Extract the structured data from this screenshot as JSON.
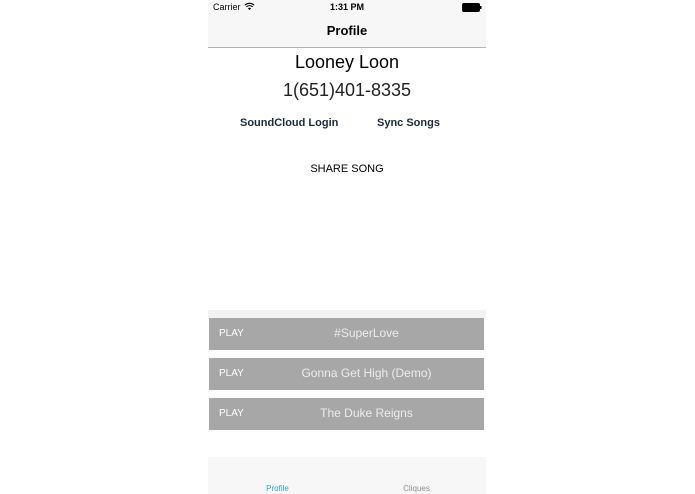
{
  "status_bar": {
    "carrier": "Carrier",
    "time": "1:31 PM"
  },
  "nav": {
    "title": "Profile"
  },
  "profile": {
    "name": "Looney Loon",
    "phone": "1(651)401-8335"
  },
  "actions": {
    "soundcloud_login": "SoundCloud Login",
    "sync_songs": "Sync Songs",
    "share_song": "SHARE SONG"
  },
  "songs": [
    {
      "play_label": "PLAY",
      "title": "#SuperLove"
    },
    {
      "play_label": "PLAY",
      "title": "Gonna Get High (Demo)"
    },
    {
      "play_label": "PLAY",
      "title": "The Duke Reigns"
    }
  ],
  "tabs": [
    {
      "label": "Profile",
      "selected": true
    },
    {
      "label": "Cliques",
      "selected": false
    }
  ],
  "colors": {
    "accent": "#2f9bd6",
    "song_row": "#a7a7a7",
    "link_text": "#1a2a3a"
  }
}
